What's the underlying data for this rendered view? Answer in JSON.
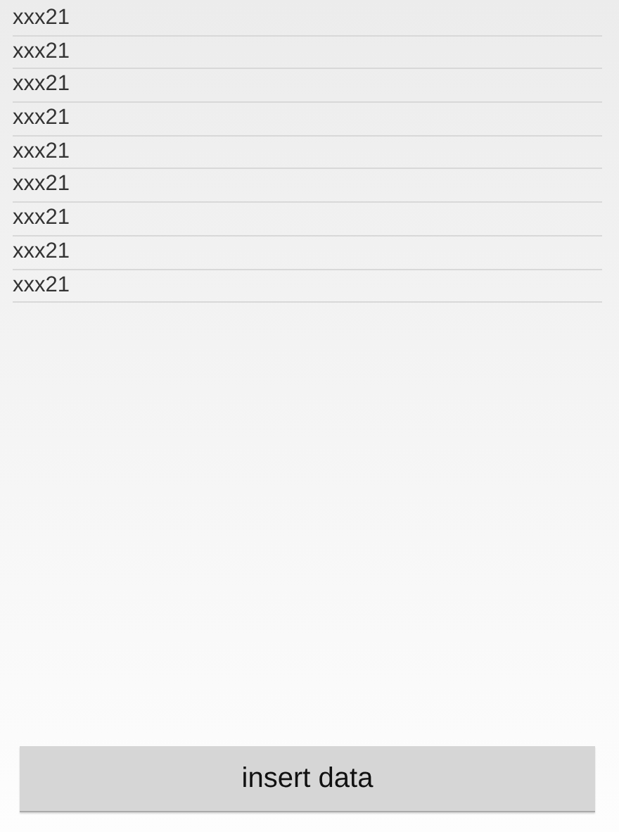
{
  "items": [
    "xxx21",
    "xxx21",
    "xxx21",
    "xxx21",
    "xxx21",
    "xxx21",
    "xxx21",
    "xxx21",
    "xxx21"
  ],
  "button": "insert data"
}
